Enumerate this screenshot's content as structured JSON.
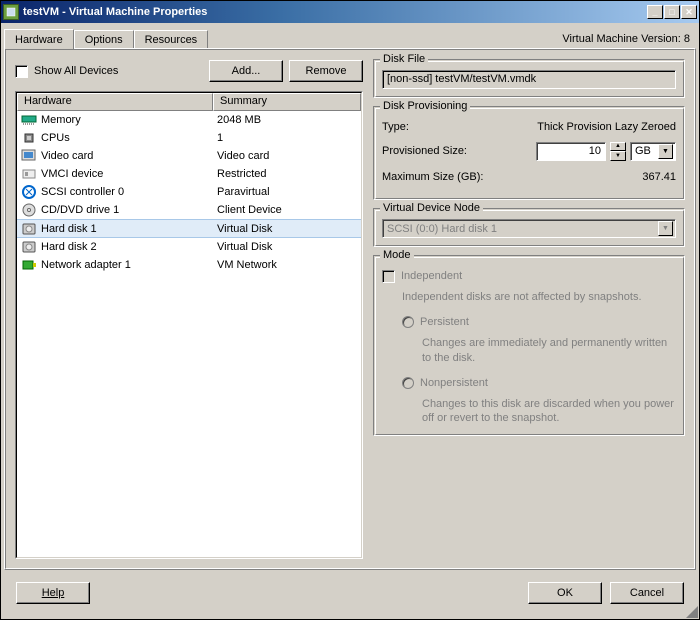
{
  "window": {
    "title": "testVM - Virtual Machine Properties"
  },
  "tabs": {
    "hardware": "Hardware",
    "options": "Options",
    "resources": "Resources",
    "version": "Virtual Machine Version: 8"
  },
  "controls": {
    "show_all": "Show All Devices",
    "add": "Add...",
    "remove": "Remove"
  },
  "hw_header": {
    "c1": "Hardware",
    "c2": "Summary"
  },
  "hw": [
    {
      "icon": "memory",
      "name": "Memory",
      "summary": "2048 MB"
    },
    {
      "icon": "cpu",
      "name": "CPUs",
      "summary": "1"
    },
    {
      "icon": "video",
      "name": "Video card",
      "summary": "Video card"
    },
    {
      "icon": "vmci",
      "name": "VMCI device",
      "summary": "Restricted"
    },
    {
      "icon": "scsi",
      "name": "SCSI controller 0",
      "summary": "Paravirtual"
    },
    {
      "icon": "cd",
      "name": "CD/DVD drive 1",
      "summary": "Client Device"
    },
    {
      "icon": "disk",
      "name": "Hard disk 1",
      "summary": "Virtual Disk",
      "selected": true
    },
    {
      "icon": "disk",
      "name": "Hard disk 2",
      "summary": "Virtual Disk"
    },
    {
      "icon": "nic",
      "name": "Network adapter 1",
      "summary": "VM Network"
    }
  ],
  "disk_file": {
    "group": "Disk File",
    "value": "[non-ssd] testVM/testVM.vmdk"
  },
  "provisioning": {
    "group": "Disk Provisioning",
    "type_label": "Type:",
    "type_value": "Thick Provision Lazy Zeroed",
    "size_label": "Provisioned Size:",
    "size_value": "10",
    "size_unit": "GB",
    "max_label": "Maximum Size (GB):",
    "max_value": "367.41"
  },
  "vnode": {
    "group": "Virtual Device Node",
    "value": "SCSI (0:0) Hard disk 1"
  },
  "mode": {
    "group": "Mode",
    "independent": "Independent",
    "independent_desc": "Independent disks are not affected by snapshots.",
    "persistent": "Persistent",
    "persistent_desc": "Changes are immediately and permanently written to the disk.",
    "nonpersistent": "Nonpersistent",
    "nonpersistent_desc": "Changes to this disk are discarded when you power off or revert to the snapshot."
  },
  "buttons": {
    "help": "Help",
    "ok": "OK",
    "cancel": "Cancel"
  }
}
